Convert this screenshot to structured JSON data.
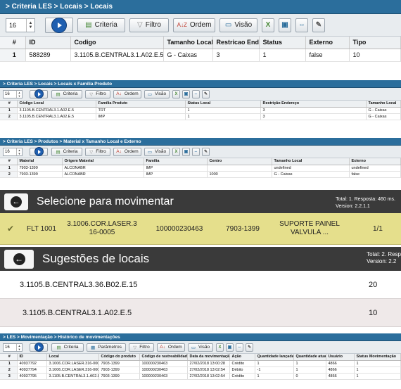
{
  "p1": {
    "breadcrumb": "> Criteria LES > Locais > Locais",
    "spinner_value": "16",
    "buttons": {
      "criteria": "Criteria",
      "filtro": "Filtro",
      "ordem": "Ordem",
      "visao": "Visão"
    },
    "columns": [
      "#",
      "ID",
      "Codigo",
      "Tamanho Local",
      "Restricao End",
      "Status",
      "Externo",
      "Tipo"
    ],
    "rows": [
      [
        "1",
        "588289",
        "3.1105.B.CENTRAL3.1.A02.E.5",
        "G - Caixas",
        "3",
        "1",
        "false",
        "10"
      ]
    ]
  },
  "p2": {
    "breadcrumb": "> Criteria LES > Locais > Locais x Família Produto",
    "spinner_value": "16",
    "buttons": {
      "criteria": "Criteria",
      "filtro": "Filtro",
      "ordem": "Ordem",
      "visao": "Visão"
    },
    "columns": [
      "#",
      "Código Local",
      "Família Produto",
      "Status Local",
      "Restrição Endereço",
      "Tamanho Local"
    ],
    "rows": [
      [
        "1",
        "3.1105.B.CENTRAL3.1.A02.E.5",
        "TRT",
        "1",
        "3",
        "G - Caixas"
      ],
      [
        "2",
        "3.1105.B.CENTRAL3.1.A02.E.5",
        "IMP",
        "1",
        "3",
        "G - Caixas"
      ]
    ]
  },
  "p3": {
    "breadcrumb": "> Criteria LES > Produtos > Material x Tamanho Local e Externo",
    "spinner_value": "16",
    "buttons": {
      "criteria": "Criteria",
      "filtro": "Filtro",
      "ordem": "Ordem",
      "visao": "Visão"
    },
    "columns": [
      "#",
      "Material",
      "Origem Material",
      "Familia",
      "Centro",
      "Tamanho Local",
      "Externo"
    ],
    "rows": [
      [
        "1",
        "7903-1399",
        "ALCONABR",
        "IMP",
        "",
        "undefined",
        "undefined"
      ],
      [
        "2",
        "7903-1399",
        "ALCONABR",
        "IMP",
        "1000",
        "G - Caixas",
        "false"
      ]
    ]
  },
  "p4": {
    "title": "Selecione para movimentar",
    "stat_line1": "Total: 1. Resposta: 460 ms.",
    "stat_line2": "Version: 2.2.1.1",
    "row": {
      "code": "FLT 1001",
      "local_a": "3.1006.COR.LASER.3",
      "local_b": "16-0005",
      "tracking": "100000230463",
      "material": "7903-1399",
      "desc_a": "SUPORTE PAINEL",
      "desc_b": "VALVULA ...",
      "count": "1/1"
    }
  },
  "p5": {
    "title": "Sugestões de locais",
    "stat_line1": "Total: 2. Resp",
    "stat_line2": "Version: 2.2",
    "items": [
      {
        "local": "3.1105.B.CENTRAL3.36.B02.E.15",
        "qty": "20"
      },
      {
        "local": "3.1105.B.CENTRAL3.1.A02.E.5",
        "qty": "10"
      }
    ]
  },
  "p6": {
    "breadcrumb": "> LES > Movimentação > Histórico de movimentações",
    "spinner_value": "16",
    "buttons": {
      "criteria": "Criteria",
      "parametros": "Parâmetros",
      "filtro": "Filtro",
      "ordem": "Ordem",
      "visao": "Visão"
    },
    "columns": [
      "#",
      "ID",
      "Local",
      "Código do produto",
      "Código de rastreabilidade",
      "Data da movimentação",
      "Ação",
      "Quantidade lançada",
      "Quantidade atual",
      "Usuário",
      "Status Movimentação"
    ],
    "rows": [
      [
        "1",
        "40937792",
        "3.1006.COR.LASER.316-0005",
        "7903-1399",
        "100000230463",
        "27/02/2018 13:00:28",
        "Crédito",
        "1",
        "1",
        "4866",
        "1"
      ],
      [
        "2",
        "40937794",
        "3.1006.COR.LASER.316-0005",
        "7903-1399",
        "100000230463",
        "27/02/2018 13:02:54",
        "Débito",
        "-1",
        "1",
        "4866",
        "1"
      ],
      [
        "3",
        "40937795",
        "3.1105.B.CENTRAL3.1.A02.E.5",
        "7903-1399",
        "100000230463",
        "27/02/2018 13:02:54",
        "Crédito",
        "1",
        "0",
        "4866",
        "1"
      ]
    ]
  },
  "colors": {
    "header_blue": "#2b6e9c",
    "dark_bar": "#3a3a3a",
    "selected_row": "#e5df8c"
  }
}
